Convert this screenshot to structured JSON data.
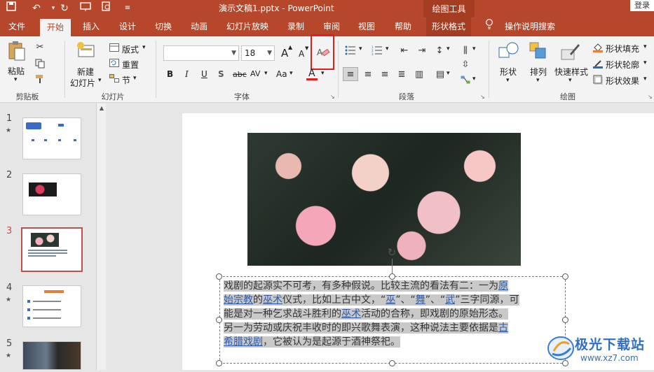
{
  "window": {
    "title": "演示文稿1.pptx - PowerPoint",
    "drawing_tools": "绘图工具",
    "login": "登录"
  },
  "tabs": [
    {
      "label": "文件"
    },
    {
      "label": "开始"
    },
    {
      "label": "插入"
    },
    {
      "label": "设计"
    },
    {
      "label": "切换"
    },
    {
      "label": "动画"
    },
    {
      "label": "幻灯片放映"
    },
    {
      "label": "录制"
    },
    {
      "label": "审阅"
    },
    {
      "label": "视图"
    },
    {
      "label": "帮助"
    },
    {
      "label": "形状格式"
    }
  ],
  "search": {
    "label": "操作说明搜索"
  },
  "ribbon": {
    "clipboard": {
      "paste": "粘贴",
      "group": "剪贴板"
    },
    "slides": {
      "new_slide": "新建",
      "new_slide2": "幻灯片",
      "layout": "版式",
      "reset": "重置",
      "section": "节",
      "group": "幻灯片"
    },
    "font": {
      "font_name": "",
      "font_size": "18",
      "group": "字体",
      "bold": "B",
      "italic": "I",
      "underline": "U",
      "shadow": "S",
      "strike": "abc",
      "spacing": "AV",
      "case": "Aa",
      "color": "A",
      "grow": "A",
      "shrink": "A"
    },
    "paragraph": {
      "group": "段落"
    },
    "drawing": {
      "shape": "形状",
      "arrange": "排列",
      "quick_styles": "快速样式",
      "fill": "形状填充",
      "outline": "形状轮廓",
      "effects": "形状效果",
      "group": "绘图"
    }
  },
  "thumbnails": [
    {
      "num": "1",
      "starred": "★"
    },
    {
      "num": "2",
      "starred": ""
    },
    {
      "num": "3",
      "starred": ""
    },
    {
      "num": "4",
      "starred": "★"
    },
    {
      "num": "5",
      "starred": "★"
    }
  ],
  "slide_text": {
    "l1a": "戏剧的起源实不可考，有多种假说。比较主流的看法有二：一为",
    "l1b": "原",
    "l2a": "始宗教",
    "l2b": "的",
    "l2c": "巫术",
    "l2d": "仪式，比如上古中文，“",
    "l2e": "巫",
    "l2f": "”、“",
    "l2g": "舞",
    "l2h": "”、“",
    "l2i": "武",
    "l2j": "”三字同源，可",
    "l3a": "能是对一种乞求战斗胜利的",
    "l3b": "巫术",
    "l3c": "活动的合称，即戏剧的原始形态。",
    "l4a": "另一为劳动或庆祝丰收时的即兴歌舞表演，这种说法主要依据是",
    "l4b": "古",
    "l5a": "希腊戏剧",
    "l5b": "，它被认为是起源于酒神祭祀。"
  },
  "watermark": {
    "name": "极光下载站",
    "url": "www.xz7.com"
  }
}
